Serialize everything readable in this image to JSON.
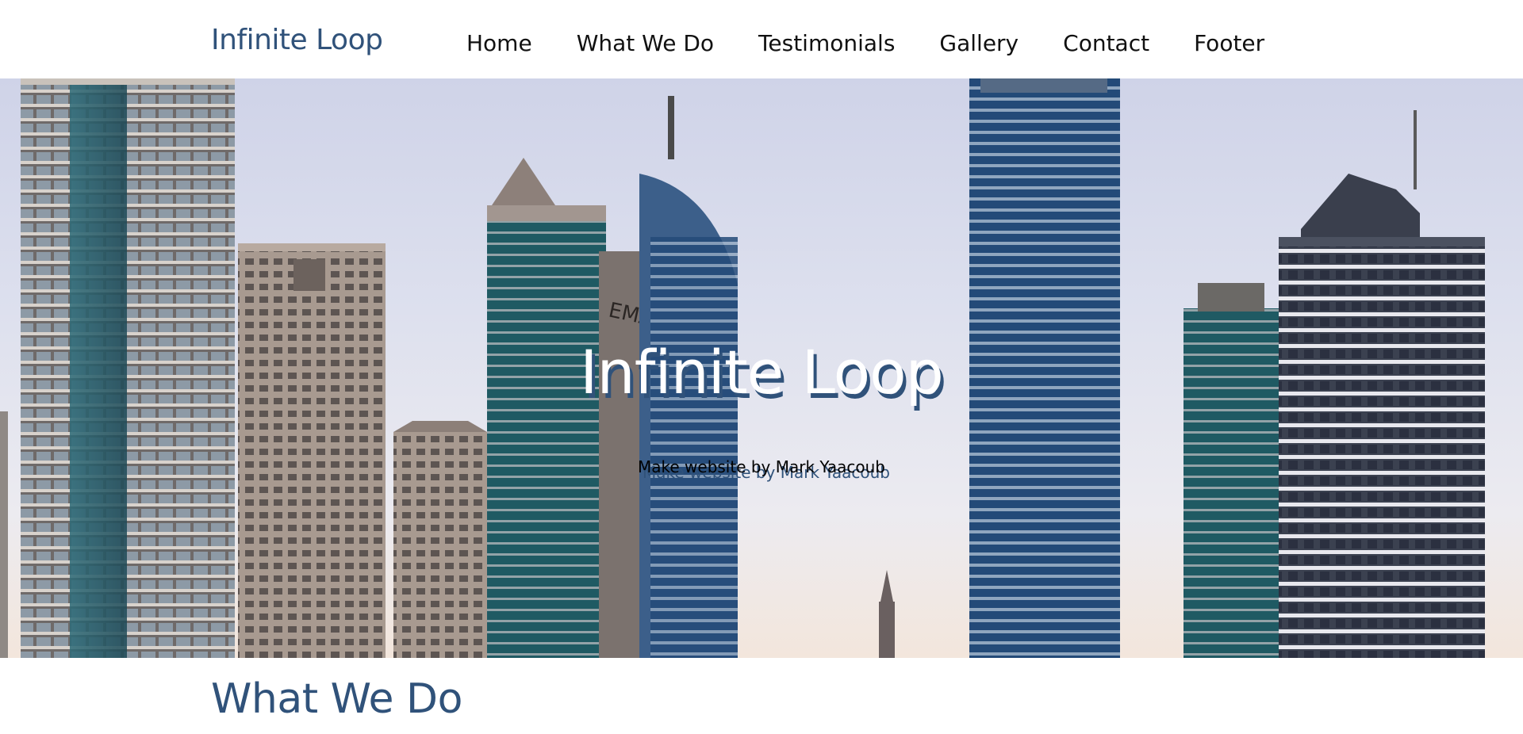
{
  "brand": {
    "name": "Infinite Loop"
  },
  "nav": {
    "items": [
      {
        "label": "Home"
      },
      {
        "label": "What We Do"
      },
      {
        "label": "Testimonials"
      },
      {
        "label": "Gallery"
      },
      {
        "label": "Contact"
      },
      {
        "label": "Footer"
      }
    ]
  },
  "hero": {
    "title": "Infinite Loop",
    "subtitle": "Make website by Mark Yaacoub",
    "building_sign": "EMAAR",
    "image": "city-skyline-photo"
  },
  "section": {
    "title": "What We Do"
  },
  "colors": {
    "brand": "#30527a",
    "nav_text": "#111111",
    "background": "#ffffff"
  }
}
